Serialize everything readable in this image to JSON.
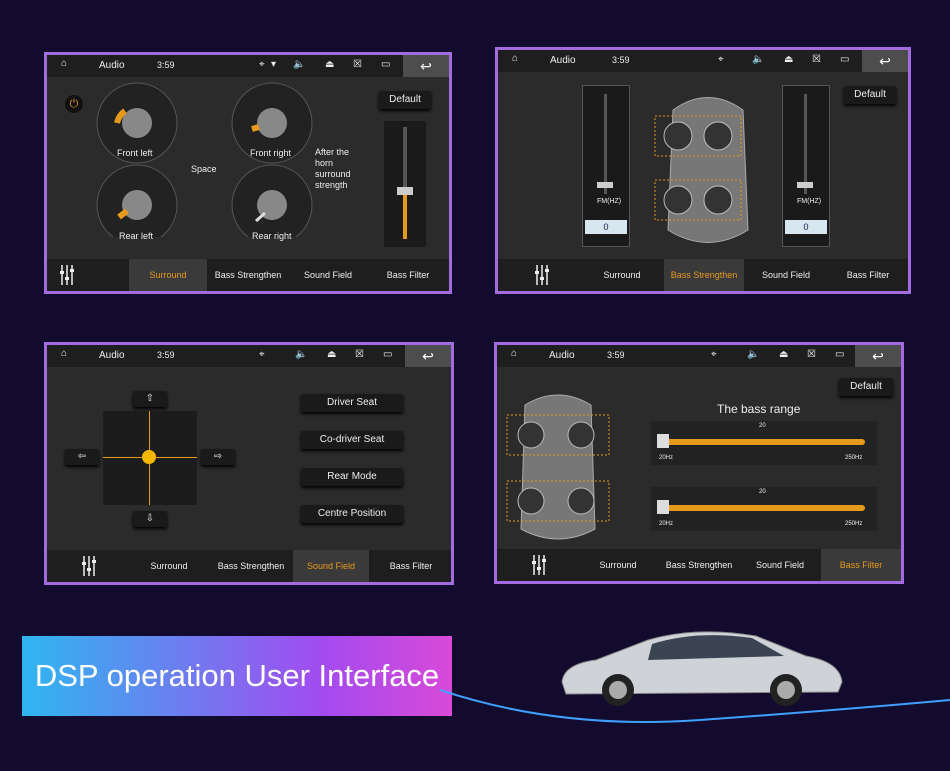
{
  "status": {
    "title": "Audio",
    "time": "3:59"
  },
  "tabs": [
    "Surround",
    "Bass Strengthen",
    "Sound Field",
    "Bass Filter"
  ],
  "p1": {
    "default": "Default",
    "fl": "Front left",
    "fr": "Front right",
    "rl": "Rear left",
    "rr": "Rear right",
    "space": "Space",
    "horn": "After the horn surround strength",
    "slider_level": 0.35
  },
  "p2": {
    "default": "Default",
    "fm": "FM(HZ)",
    "val": "0",
    "ticks_top": "12",
    "ticks_bot": "12"
  },
  "p3": {
    "buttons": [
      "Driver Seat",
      "Co-driver Seat",
      "Rear Mode",
      "Centre Position"
    ]
  },
  "p4": {
    "default": "Default",
    "heading": "The bass range",
    "s1": {
      "value": "20",
      "min": "20Hz",
      "max": "250Hz"
    },
    "s2": {
      "value": "20",
      "min": "20Hz",
      "max": "250Hz"
    }
  },
  "banner": "DSP operation User Interface",
  "colors": {
    "accent": "#e69a1c",
    "border": "#a36be0",
    "bg": "#130b2e"
  }
}
